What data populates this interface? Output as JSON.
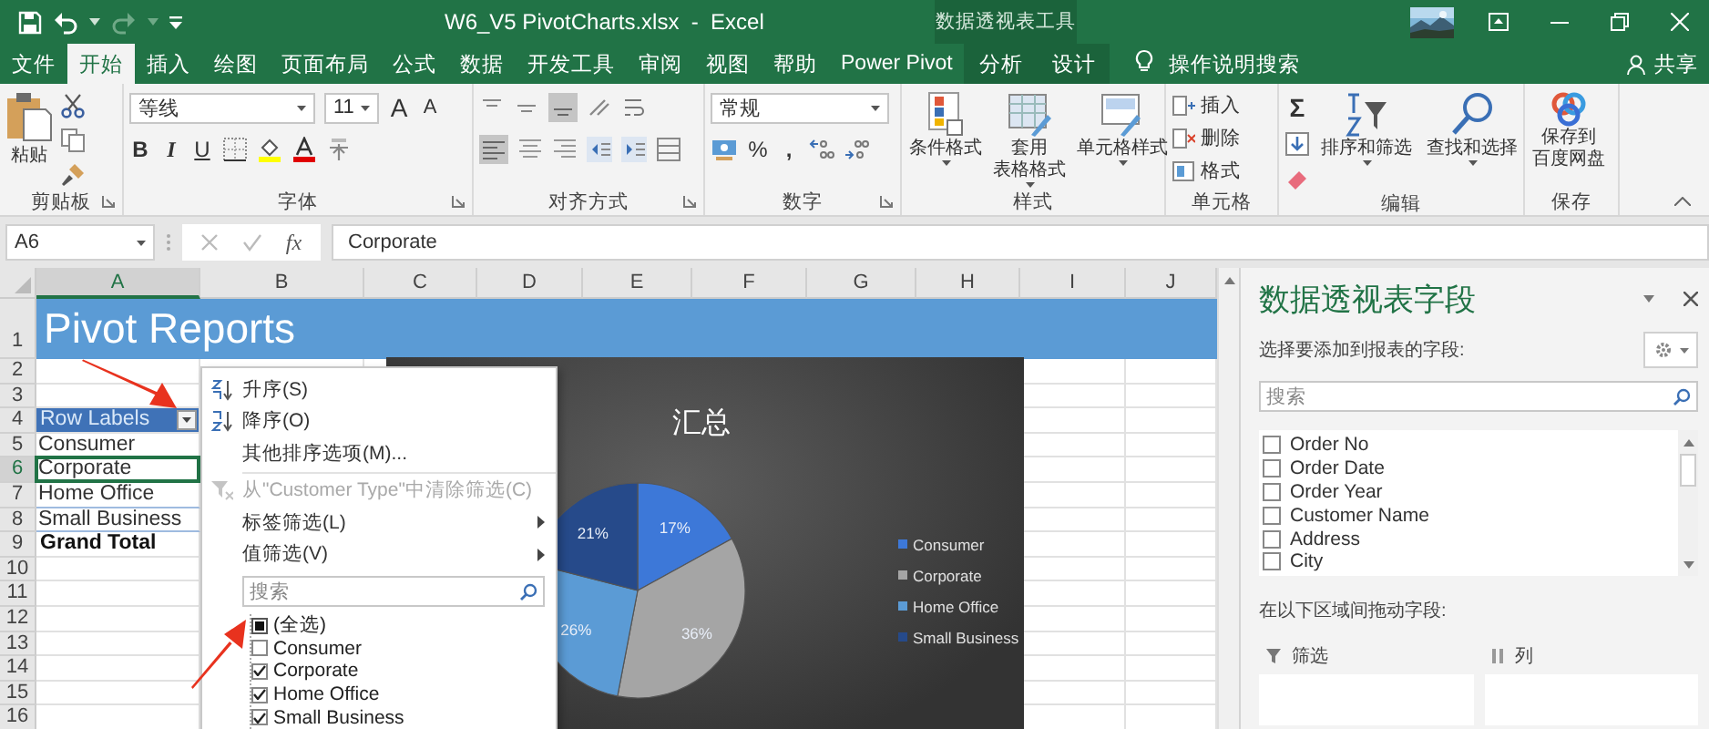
{
  "title_bar": {
    "title": "W6_V5 PivotCharts.xlsx  -  Excel",
    "context_title": "数据透视表工具"
  },
  "tabs": [
    {
      "label": "文件",
      "selected": false,
      "contextual": false
    },
    {
      "label": "开始",
      "selected": true,
      "contextual": false
    },
    {
      "label": "插入",
      "selected": false,
      "contextual": false
    },
    {
      "label": "绘图",
      "selected": false,
      "contextual": false
    },
    {
      "label": "页面布局",
      "selected": false,
      "contextual": false
    },
    {
      "label": "公式",
      "selected": false,
      "contextual": false
    },
    {
      "label": "数据",
      "selected": false,
      "contextual": false
    },
    {
      "label": "开发工具",
      "selected": false,
      "contextual": false
    },
    {
      "label": "审阅",
      "selected": false,
      "contextual": false
    },
    {
      "label": "视图",
      "selected": false,
      "contextual": false
    },
    {
      "label": "帮助",
      "selected": false,
      "contextual": false
    },
    {
      "label": "Power Pivot",
      "selected": false,
      "contextual": false
    },
    {
      "label": "分析",
      "selected": false,
      "contextual": true
    },
    {
      "label": "设计",
      "selected": false,
      "contextual": true
    }
  ],
  "tell_me": "操作说明搜索",
  "share": "共享",
  "ribbon": {
    "clipboard": {
      "label": "剪贴板",
      "paste": "粘贴"
    },
    "font": {
      "label": "字体",
      "name": "等线",
      "size": "11",
      "grow": "A",
      "shrink": "A",
      "bold": "B",
      "italic": "I",
      "underline": "U"
    },
    "alignment": {
      "label": "对齐方式"
    },
    "number": {
      "label": "数字",
      "format": "常规",
      "percent": "%",
      "comma": ","
    },
    "styles": {
      "label": "样式",
      "buttons": [
        {
          "kind": "conditional",
          "lines": [
            "条件格式"
          ]
        },
        {
          "kind": "table",
          "lines": [
            "套用",
            "表格格式"
          ]
        },
        {
          "kind": "cell",
          "lines": [
            "单元格样式"
          ]
        }
      ]
    },
    "cells": {
      "label": "单元格",
      "buttons": [
        {
          "kind": "insert",
          "label": "插入"
        },
        {
          "kind": "delete",
          "label": "删除"
        },
        {
          "kind": "format",
          "label": "格式"
        }
      ]
    },
    "editing": {
      "label": "编辑",
      "autosum": "Σ",
      "buttons": [
        {
          "kind": "sort",
          "label": "排序和筛选"
        },
        {
          "kind": "find",
          "label": "查找和选择"
        }
      ]
    },
    "save": {
      "label": "保存",
      "button_lines": [
        "保存到",
        "百度网盘"
      ]
    }
  },
  "formula_bar": {
    "name_box": "A6",
    "fx": "fx",
    "value": "Corporate"
  },
  "sheet": {
    "columns": [
      {
        "label": "A",
        "selected": true
      },
      {
        "label": "B",
        "selected": false
      },
      {
        "label": "C",
        "selected": false
      },
      {
        "label": "D",
        "selected": false
      },
      {
        "label": "E",
        "selected": false
      },
      {
        "label": "F",
        "selected": false
      },
      {
        "label": "G",
        "selected": false
      },
      {
        "label": "H",
        "selected": false
      },
      {
        "label": "I",
        "selected": false
      },
      {
        "label": "J",
        "selected": false
      }
    ],
    "rows": [
      {
        "label": "1",
        "selected": false
      },
      {
        "label": "2",
        "selected": false
      },
      {
        "label": "3",
        "selected": false
      },
      {
        "label": "4",
        "selected": false
      },
      {
        "label": "5",
        "selected": false
      },
      {
        "label": "6",
        "selected": true
      },
      {
        "label": "7",
        "selected": false
      },
      {
        "label": "8",
        "selected": false
      },
      {
        "label": "9",
        "selected": false
      },
      {
        "label": "10",
        "selected": false
      },
      {
        "label": "11",
        "selected": false
      },
      {
        "label": "12",
        "selected": false
      },
      {
        "label": "13",
        "selected": false
      },
      {
        "label": "14",
        "selected": false
      },
      {
        "label": "15",
        "selected": false
      },
      {
        "label": "16",
        "selected": false
      }
    ],
    "title": "Pivot Reports",
    "pivot": {
      "header": "Row Labels",
      "items": [
        {
          "label": "Consumer",
          "selected": false
        },
        {
          "label": "Corporate",
          "selected": true
        },
        {
          "label": "Home Office",
          "selected": false
        },
        {
          "label": "Small Business",
          "selected": false
        }
      ],
      "grand_total": "Grand Total"
    }
  },
  "chart": {
    "chart_data": {
      "type": "pie",
      "title": "汇总",
      "categories": [
        "Consumer",
        "Corporate",
        "Home Office",
        "Small Business"
      ],
      "values": [
        17,
        36,
        26,
        21
      ],
      "value_labels": [
        "17%",
        "36%",
        "26%",
        "21%"
      ],
      "legend": "right"
    }
  },
  "filter_menu": {
    "items": [
      {
        "kind": "ascending",
        "label": "升序(S)",
        "disabled": false
      },
      {
        "kind": "descending",
        "label": "降序(O)",
        "disabled": false
      },
      {
        "kind": "plain",
        "label": "其他排序选项(M)...",
        "disabled": false
      },
      {
        "kind": "clear",
        "label": "从\"Customer Type\"中清除筛选(C)",
        "disabled": true
      },
      {
        "kind": "submenu",
        "label": "标签筛选(L)",
        "disabled": false
      },
      {
        "kind": "submenu",
        "label": "值筛选(V)",
        "disabled": false
      }
    ],
    "search_placeholder": "搜索",
    "values": [
      {
        "label": "(全选)",
        "checked": false,
        "indeterminate": true
      },
      {
        "label": "Consumer",
        "checked": false,
        "indeterminate": false
      },
      {
        "label": "Corporate",
        "checked": true,
        "indeterminate": false
      },
      {
        "label": "Home Office",
        "checked": true,
        "indeterminate": false
      },
      {
        "label": "Small Business",
        "checked": true,
        "indeterminate": false
      }
    ]
  },
  "pivot_pane": {
    "title": "数据透视表字段",
    "subtitle": "选择要添加到报表的字段:",
    "search_placeholder": "搜索",
    "fields": [
      {
        "label": "Order No",
        "checked": false
      },
      {
        "label": "Order Date",
        "checked": false
      },
      {
        "label": "Order Year",
        "checked": false
      },
      {
        "label": "Customer Name",
        "checked": false
      },
      {
        "label": "Address",
        "checked": false
      },
      {
        "label": "City",
        "checked": false
      }
    ],
    "areas_hint": "在以下区域间拖动字段:",
    "areas": [
      {
        "kind": "filters",
        "label": "筛选"
      },
      {
        "kind": "columns",
        "label": "列"
      }
    ]
  }
}
